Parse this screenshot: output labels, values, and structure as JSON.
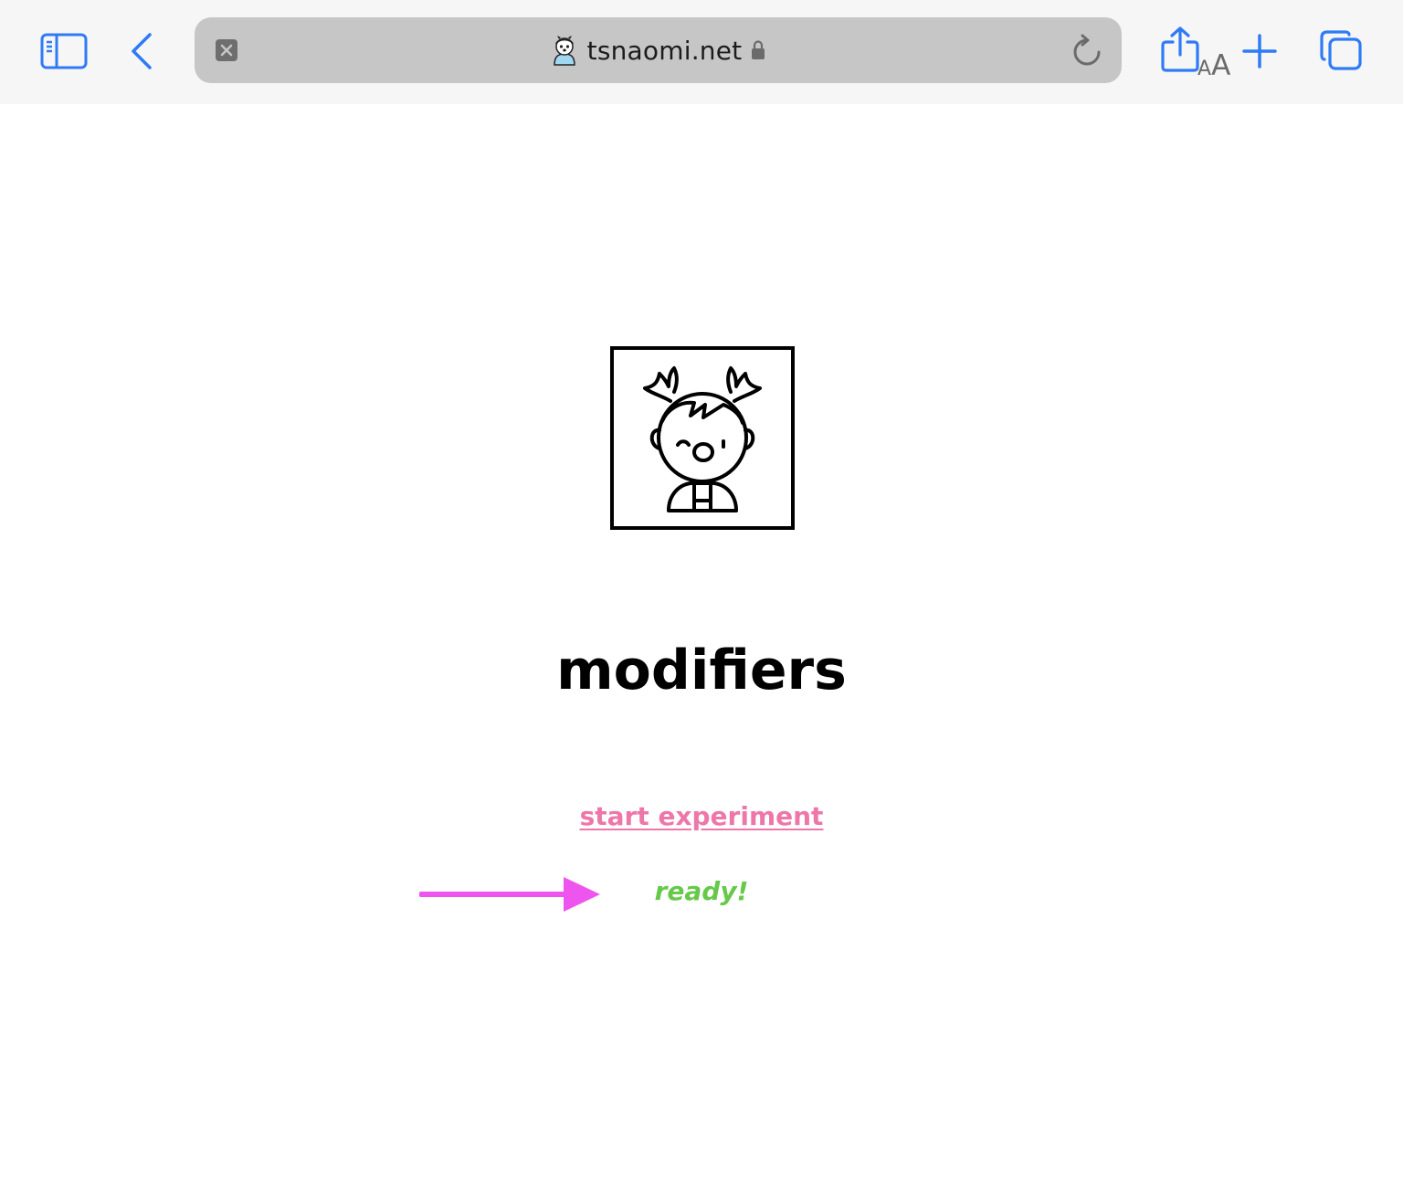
{
  "browser": {
    "url": "tsnaomi.net",
    "reader_small": "A",
    "reader_big": "A",
    "accent_color": "#2f7bf5",
    "icons": [
      "sidebar-icon",
      "back-icon",
      "close-tab-icon",
      "site-favicon",
      "lock-icon",
      "reload-icon",
      "share-icon",
      "new-tab-icon",
      "tabs-overview-icon"
    ]
  },
  "page": {
    "avatar_icon": "girl-avatar-icon",
    "title": "modifiers",
    "start_link": "start experiment",
    "start_link_color": "#ee77aa",
    "status": "ready!",
    "status_color": "#66c94a",
    "arrow_color": "#ee55ee"
  }
}
